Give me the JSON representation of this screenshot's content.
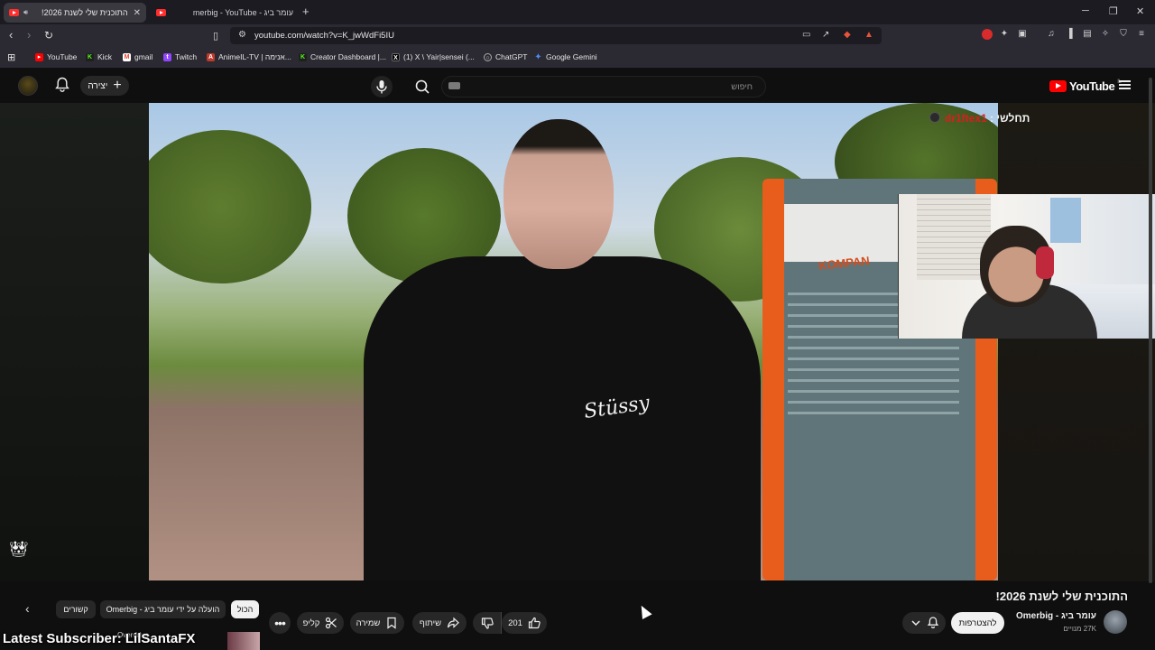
{
  "browser": {
    "tabs": [
      {
        "title": "התוכנית שלי לשנת 2026!",
        "audio": "speaker-icon",
        "active": true
      },
      {
        "title": "עומר ביג - Omerbig - YouTube",
        "active": false
      }
    ],
    "url": "youtube.com/watch?v=K_jwWdFi5IU",
    "bookmarks": [
      {
        "label": "YouTube",
        "icon": "youtube-icon",
        "color": "#ff0000"
      },
      {
        "label": "Kick",
        "icon": "kick-icon",
        "color": "#53fc18"
      },
      {
        "label": "gmail",
        "icon": "gmail-icon",
        "color": "#ea4335"
      },
      {
        "label": "Twitch",
        "icon": "twitch-icon",
        "color": "#9146ff"
      },
      {
        "label": "AnimeIL-TV | אנימה...",
        "icon": "anime-icon",
        "color": "#c0392b"
      },
      {
        "label": "Creator Dashboard |...",
        "icon": "kick-icon",
        "color": "#53fc18"
      },
      {
        "label": "(1) X \\ Yair|sensei (...",
        "icon": "x-icon",
        "color": "#000000"
      },
      {
        "label": "ChatGPT",
        "icon": "chatgpt-icon",
        "color": "#ffffff"
      },
      {
        "label": "Google Gemini",
        "icon": "gemini-icon",
        "color": "#4b8bf5"
      }
    ]
  },
  "youtube": {
    "create_label": "יצירה",
    "search_placeholder": "חיפוש",
    "logo_text": "YouTube",
    "logo_region": "IL"
  },
  "stream_overlay": {
    "chat_prefix": "תחלשי :",
    "chat_nick": "dr1ftex1",
    "latest_subscriber": "Latest Subscriber: LilSantaFX",
    "overlay_small": "Overdrive"
  },
  "video": {
    "title": "התוכנית שלי לשנת 2026!",
    "shirt_text": "Stüssy",
    "sign_brand": "KOMPAN"
  },
  "channel": {
    "name": "עומר ביג - Omerbig",
    "subscribers": "27K מנויים",
    "join_label": "להצטרפות"
  },
  "actions": {
    "likes": "201",
    "share_label": "שיתוף",
    "save_label": "שמירה",
    "clip_label": "קליפ"
  },
  "chips": [
    {
      "label": "הכול",
      "selected": true
    },
    {
      "label": "הועלה על ידי עומר ביג - Omerbig",
      "selected": false
    },
    {
      "label": "קשורים",
      "selected": false
    }
  ],
  "colors": {
    "accent": "#ff0000",
    "chat_nick": "#d61f1f",
    "background": "#0f0f0f"
  }
}
